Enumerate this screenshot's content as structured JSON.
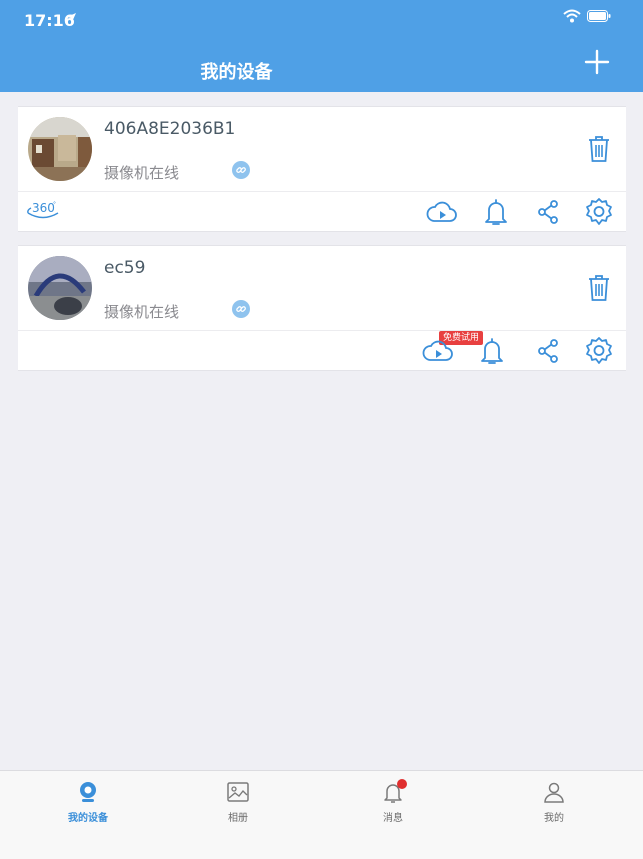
{
  "status_bar": {
    "time": "17:16"
  },
  "header": {
    "title": "我的设备"
  },
  "devices": [
    {
      "name": "406A8E2036B1",
      "status": "摄像机在线",
      "has_360": true,
      "trial_badge": ""
    },
    {
      "name": "ec59",
      "status": "摄像机在线",
      "has_360": false,
      "trial_badge": "免费试用"
    }
  ],
  "tabbar": {
    "items": [
      {
        "label": "我的设备",
        "icon": "camera-icon",
        "active": true
      },
      {
        "label": "相册",
        "icon": "photo-album-icon",
        "active": false
      },
      {
        "label": "消息",
        "icon": "bell-icon",
        "active": false,
        "badge": true
      },
      {
        "label": "我的",
        "icon": "user-icon",
        "active": false
      }
    ]
  },
  "colors": {
    "brand": "#4fa0e6",
    "accent_icon": "#3b8fd9",
    "badge_red": "#e02f2f"
  }
}
